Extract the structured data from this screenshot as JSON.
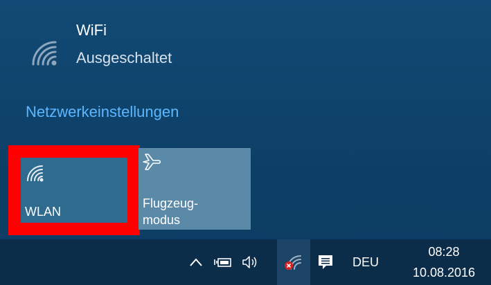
{
  "network": {
    "name": "WiFi",
    "status": "Ausgeschaltet",
    "icon": "wifi-icon"
  },
  "settings_link": "Netzwerkeinstellungen",
  "tiles": [
    {
      "label": "WLAN",
      "icon": "wifi-icon",
      "highlighted": true
    },
    {
      "label_line1": "Flugzeug-",
      "label_line2": "modus",
      "icon": "airplane-icon"
    }
  ],
  "taskbar": {
    "language": "DEU",
    "time": "08:28",
    "date": "10.08.2016",
    "icons": [
      "chevron-up-icon",
      "battery-icon",
      "volume-icon",
      "wifi-off-icon",
      "action-center-icon"
    ]
  },
  "colors": {
    "accent_link": "#5cb7ff",
    "highlight": "#ff0000",
    "tile_active": "#2f6b8f",
    "tile_inactive": "#5b8aa8",
    "taskbar": "#0c2d4a"
  }
}
